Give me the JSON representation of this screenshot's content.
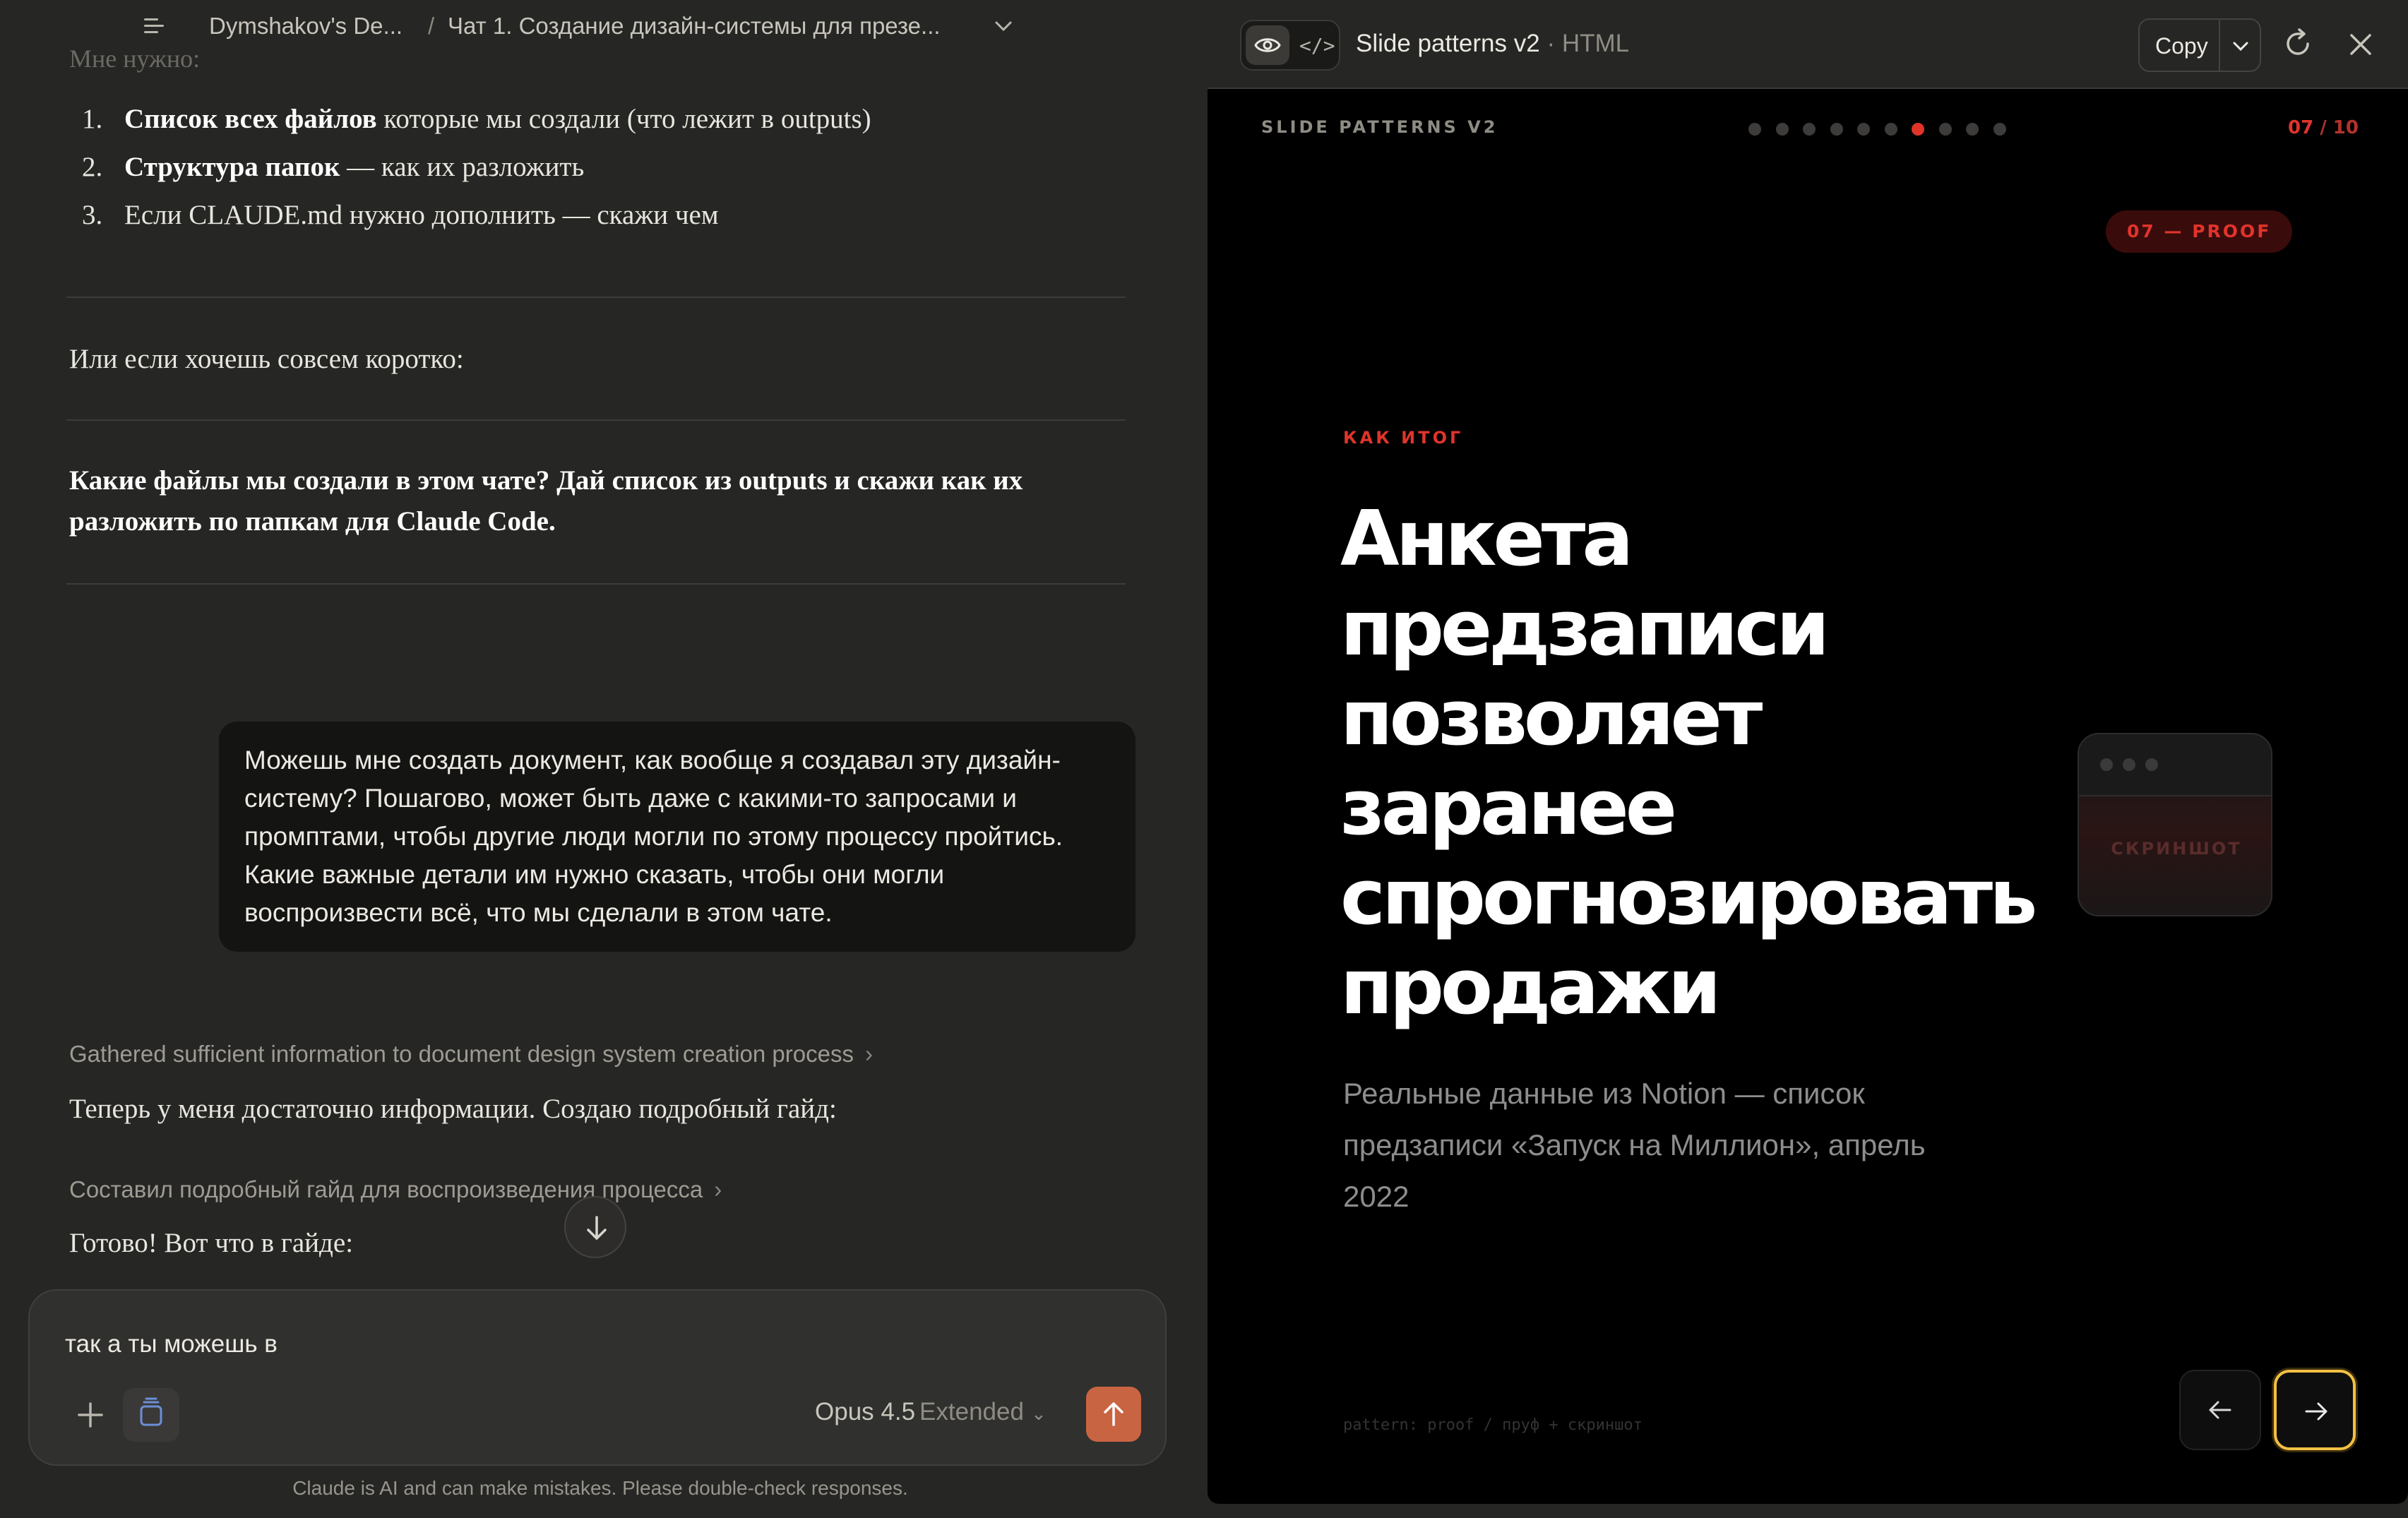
{
  "topbar": {
    "org": "Dymshakov's De...",
    "separator": "/",
    "chat_title": "Чат 1. Создание дизайн-системы для презе..."
  },
  "conversation": {
    "cut_line": "Мне нужно:",
    "steps": [
      {
        "num": "1.",
        "bold": "Список всех файлов",
        "rest": " которые мы создали (что лежит в outputs)"
      },
      {
        "num": "2.",
        "bold": "Структура папок",
        "rest": " — как их разложить"
      },
      {
        "num": "3.",
        "bold": "",
        "rest": "Если CLAUDE.md нужно дополнить — скажи чем"
      }
    ],
    "short_intro": "Или если хочешь совсем коротко:",
    "short_prompt": "Какие файлы мы создали в этом чате? Дай список из outputs и скажи как их разложить по папкам для Claude Code.",
    "user_message": "Можешь мне создать документ, как вообще я создавал эту дизайн-систему? Пошагово, может быть даже с какими-то запросами и промптами, чтобы другие люди могли по этому процессу пройтись. Какие важные детали им нужно сказать, чтобы они могли воспроизвести всё, что мы сделали в этом чате.",
    "thinking_1": "Gathered sufficient information to document design system creation process",
    "reply_1": "Теперь у меня достаточно информации. Создаю подробный гайд:",
    "thinking_2": "Составил подробный гайд для воспроизведения процесса",
    "reply_2": "Готово! Вот что в гайде:"
  },
  "composer": {
    "input_value": "так а ты можешь в",
    "model": "Opus 4.5",
    "mode": "Extended"
  },
  "disclaimer": "Claude is AI and can make mistakes. Please double-check responses.",
  "panel": {
    "title": "Slide patterns v2",
    "title_sep": " · ",
    "format": "HTML",
    "copy_label": "Copy"
  },
  "slide": {
    "header": "SLIDE PATTERNS V2",
    "total_dots": 10,
    "active_dot": 7,
    "page_current": "07",
    "page_sep": " / ",
    "page_total": "10",
    "tag": "07 — PROOF",
    "kicker": "КАК ИТОГ",
    "headline": "Анкета предзаписи позволяет заранее спрогнозировать продажи",
    "lead": "Реальные данные из Notion — список предзаписи «Запуск на Миллион», апрель 2022",
    "screenshot_label": "СКРИНШОТ",
    "footnote": "pattern: proof / пруф + скриншот"
  },
  "colors": {
    "accent_red": "#e0342b",
    "send_orange": "#c96442",
    "focus_ring": "#f2c043"
  }
}
